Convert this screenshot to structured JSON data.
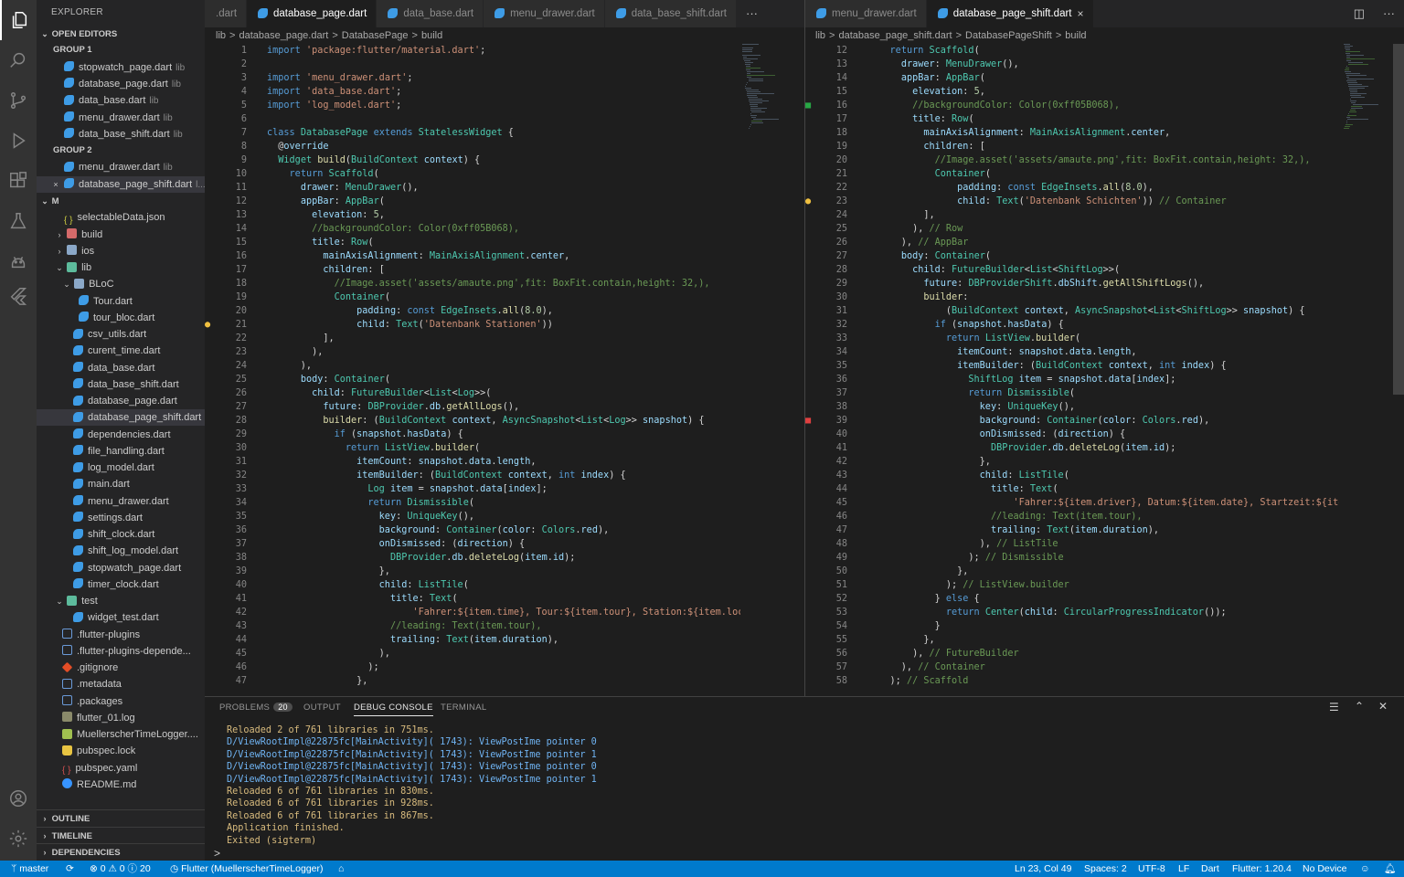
{
  "explorer": {
    "title": "EXPLORER"
  },
  "sidebar": {
    "open_editors": "OPEN EDITORS",
    "group1": "GROUP 1",
    "group2": "GROUP 2",
    "g1": [
      {
        "name": "stopwatch_page.dart",
        "dir": "lib"
      },
      {
        "name": "database_page.dart",
        "dir": "lib"
      },
      {
        "name": "data_base.dart",
        "dir": "lib"
      },
      {
        "name": "menu_drawer.dart",
        "dir": "lib"
      },
      {
        "name": "data_base_shift.dart",
        "dir": "lib"
      }
    ],
    "g2": [
      {
        "name": "menu_drawer.dart",
        "dir": "lib"
      },
      {
        "name": "database_page_shift.dart",
        "dir": "l..."
      }
    ],
    "root": "M",
    "tree": [
      "selectableData.json",
      "build",
      "ios",
      "lib",
      "BLoC",
      "Tour.dart",
      "tour_bloc.dart",
      "csv_utils.dart",
      "curent_time.dart",
      "data_base.dart",
      "data_base_shift.dart",
      "database_page.dart",
      "database_page_shift.dart",
      "dependencies.dart",
      "file_handling.dart",
      "log_model.dart",
      "main.dart",
      "menu_drawer.dart",
      "settings.dart",
      "shift_clock.dart",
      "shift_log_model.dart",
      "stopwatch_page.dart",
      "timer_clock.dart",
      "test",
      "widget_test.dart",
      ".flutter-plugins",
      ".flutter-plugins-depende...",
      ".gitignore",
      ".metadata",
      ".packages",
      "flutter_01.log",
      "MuellerscherTimeLogger....",
      "pubspec.lock",
      "pubspec.yaml",
      "README.md"
    ],
    "outline": "OUTLINE",
    "timeline": "TIMELINE",
    "dependencies": "DEPENDENCIES"
  },
  "tabs_left": [
    ".dart",
    "database_page.dart",
    "data_base.dart",
    "menu_drawer.dart",
    "data_base_shift.dart"
  ],
  "tabs_right": [
    "menu_drawer.dart",
    "database_page_shift.dart"
  ],
  "more": "···",
  "crumbs_left": [
    "lib",
    ">",
    "database_page.dart",
    ">",
    "DatabasePage",
    ">",
    "build"
  ],
  "crumbs_right": [
    "lib",
    ">",
    "database_page_shift.dart",
    ">",
    "DatabasePageShift",
    ">",
    "build"
  ],
  "panel": {
    "tabs": [
      "PROBLEMS",
      "OUTPUT",
      "DEBUG CONSOLE",
      "TERMINAL"
    ],
    "problems_count": "20",
    "console": [
      "Reloaded 2 of 761 libraries in 751ms.",
      "D/ViewRootImpl@22875fc[MainActivity]( 1743): ViewPostIme pointer 0",
      "D/ViewRootImpl@22875fc[MainActivity]( 1743): ViewPostIme pointer 1",
      "D/ViewRootImpl@22875fc[MainActivity]( 1743): ViewPostIme pointer 0",
      "D/ViewRootImpl@22875fc[MainActivity]( 1743): ViewPostIme pointer 1",
      "Reloaded 6 of 761 libraries in 830ms.",
      "Reloaded 6 of 761 libraries in 928ms.",
      "Reloaded 6 of 761 libraries in 867ms.",
      "Application finished.",
      "Exited (sigterm)"
    ],
    "prompt": ">"
  },
  "status": {
    "branch": "master",
    "sync": "⟳",
    "problems": "⊗ 0 ⚠ 0 ⓘ 20",
    "flutter_app": "Flutter (MuellerscherTimeLogger)",
    "home": "⌂",
    "position": "Ln 23, Col 49",
    "spaces": "Spaces: 2",
    "encoding": "UTF-8",
    "eol": "LF",
    "lang": "Dart",
    "flutter": "Flutter: 1.20.4",
    "device": "No Device"
  },
  "left_code": [
    [
      "1",
      "import 'package:flutter/material.dart';"
    ],
    [
      "2",
      ""
    ],
    [
      "3",
      "import 'menu_drawer.dart';"
    ],
    [
      "4",
      "import 'data_base.dart';"
    ],
    [
      "5",
      "import 'log_model.dart';"
    ],
    [
      "6",
      ""
    ],
    [
      "7",
      "class DatabasePage extends StatelessWidget {"
    ],
    [
      "8",
      "  @override"
    ],
    [
      "9",
      "  Widget build(BuildContext context) {"
    ],
    [
      "10",
      "    return Scaffold("
    ],
    [
      "11",
      "      drawer: MenuDrawer(),"
    ],
    [
      "12",
      "      appBar: AppBar("
    ],
    [
      "13",
      "        elevation: 5,"
    ],
    [
      "14",
      "        //backgroundColor: Color(0xff05B068),"
    ],
    [
      "15",
      "        title: Row("
    ],
    [
      "16",
      "          mainAxisAlignment: MainAxisAlignment.center,"
    ],
    [
      "17",
      "          children: ["
    ],
    [
      "18",
      "            //Image.asset('assets/amaute.png',fit: BoxFit.contain,height: 32,),"
    ],
    [
      "19",
      "            Container("
    ],
    [
      "20",
      "                padding: const EdgeInsets.all(8.0),"
    ],
    [
      "21",
      "                child: Text('Datenbank Stationen'))"
    ],
    [
      "22",
      "          ],"
    ],
    [
      "23",
      "        ),"
    ],
    [
      "24",
      "      ),"
    ],
    [
      "25",
      "      body: Container("
    ],
    [
      "26",
      "        child: FutureBuilder<List<Log>>("
    ],
    [
      "27",
      "          future: DBProvider.db.getAllLogs(),"
    ],
    [
      "28",
      "          builder: (BuildContext context, AsyncSnapshot<List<Log>> snapshot) {"
    ],
    [
      "29",
      "            if (snapshot.hasData) {"
    ],
    [
      "30",
      "              return ListView.builder("
    ],
    [
      "31",
      "                itemCount: snapshot.data.length,"
    ],
    [
      "32",
      "                itemBuilder: (BuildContext context, int index) {"
    ],
    [
      "33",
      "                  Log item = snapshot.data[index];"
    ],
    [
      "34",
      "                  return Dismissible("
    ],
    [
      "35",
      "                    key: UniqueKey(),"
    ],
    [
      "36",
      "                    background: Container(color: Colors.red),"
    ],
    [
      "37",
      "                    onDismissed: (direction) {"
    ],
    [
      "38",
      "                      DBProvider.db.deleteLog(item.id);"
    ],
    [
      "39",
      "                    },"
    ],
    [
      "40",
      "                    child: ListTile("
    ],
    [
      "41",
      "                      title: Text("
    ],
    [
      "42",
      "                          'Fahrer:${item.time}, Tour:${item.tour}, Station:${item.locati"
    ],
    [
      "43",
      "                      //leading: Text(item.tour),"
    ],
    [
      "44",
      "                      trailing: Text(item.duration),"
    ],
    [
      "45",
      "                    ),"
    ],
    [
      "46",
      "                  );"
    ],
    [
      "47",
      "                },"
    ]
  ],
  "right_code": [
    [
      "12",
      "    return Scaffold("
    ],
    [
      "13",
      "      drawer: MenuDrawer(),"
    ],
    [
      "14",
      "      appBar: AppBar("
    ],
    [
      "15",
      "        elevation: 5,"
    ],
    [
      "16",
      "        //backgroundColor: Color(0xff05B068),"
    ],
    [
      "17",
      "        title: Row("
    ],
    [
      "18",
      "          mainAxisAlignment: MainAxisAlignment.center,"
    ],
    [
      "19",
      "          children: ["
    ],
    [
      "20",
      "            //Image.asset('assets/amaute.png',fit: BoxFit.contain,height: 32,),"
    ],
    [
      "21",
      "            Container("
    ],
    [
      "22",
      "                padding: const EdgeInsets.all(8.0),"
    ],
    [
      "23",
      "                child: Text('Datenbank Schichten')) // Container"
    ],
    [
      "24",
      "          ],"
    ],
    [
      "25",
      "        ), // Row"
    ],
    [
      "26",
      "      ), // AppBar"
    ],
    [
      "27",
      "      body: Container("
    ],
    [
      "28",
      "        child: FutureBuilder<List<ShiftLog>>("
    ],
    [
      "29",
      "          future: DBProviderShift.dbShift.getAllShiftLogs(),"
    ],
    [
      "30",
      "          builder:"
    ],
    [
      "31",
      "              (BuildContext context, AsyncSnapshot<List<ShiftLog>> snapshot) {"
    ],
    [
      "32",
      "            if (snapshot.hasData) {"
    ],
    [
      "33",
      "              return ListView.builder("
    ],
    [
      "34",
      "                itemCount: snapshot.data.length,"
    ],
    [
      "35",
      "                itemBuilder: (BuildContext context, int index) {"
    ],
    [
      "36",
      "                  ShiftLog item = snapshot.data[index];"
    ],
    [
      "37",
      "                  return Dismissible("
    ],
    [
      "38",
      "                    key: UniqueKey(),"
    ],
    [
      "39",
      "                    background: Container(color: Colors.red),"
    ],
    [
      "40",
      "                    onDismissed: (direction) {"
    ],
    [
      "41",
      "                      DBProvider.db.deleteLog(item.id);"
    ],
    [
      "42",
      "                    },"
    ],
    [
      "43",
      "                    child: ListTile("
    ],
    [
      "44",
      "                      title: Text("
    ],
    [
      "45",
      "                          'Fahrer:${item.driver}, Datum:${item.date}, Startzeit:${item.s"
    ],
    [
      "46",
      "                      //leading: Text(item.tour),"
    ],
    [
      "47",
      "                      trailing: Text(item.duration),"
    ],
    [
      "48",
      "                    ), // ListTile"
    ],
    [
      "49",
      "                  ); // Dismissible"
    ],
    [
      "50",
      "                },"
    ],
    [
      "51",
      "              ); // ListView.builder"
    ],
    [
      "52",
      "            } else {"
    ],
    [
      "53",
      "              return Center(child: CircularProgressIndicator());"
    ],
    [
      "54",
      "            }"
    ],
    [
      "55",
      "          },"
    ],
    [
      "56",
      "        ), // FutureBuilder"
    ],
    [
      "57",
      "      ), // Container"
    ],
    [
      "58",
      "    ); // Scaffold"
    ]
  ],
  "colors": {
    "accent": "#007acc",
    "activity": "#333333",
    "sidebar": "#252526",
    "editor": "#1e1e1e"
  }
}
